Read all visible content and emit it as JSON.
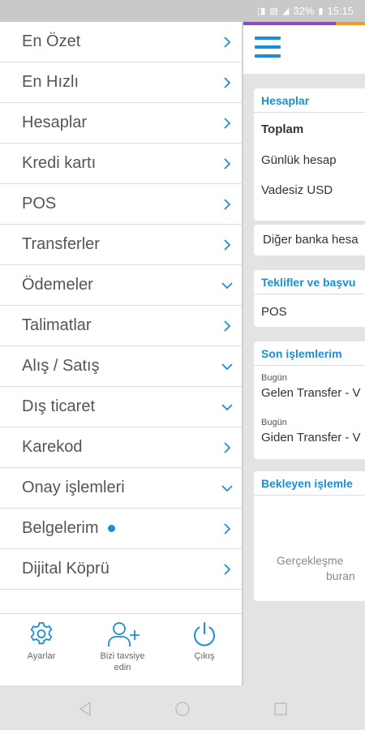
{
  "status_bar": {
    "battery": "32%",
    "time": "15:15"
  },
  "menu": {
    "items": [
      {
        "label": "En Özet",
        "chevron": "right"
      },
      {
        "label": "En Hızlı",
        "chevron": "right"
      },
      {
        "label": "Hesaplar",
        "chevron": "right"
      },
      {
        "label": "Kredi kartı",
        "chevron": "right"
      },
      {
        "label": "POS",
        "chevron": "right"
      },
      {
        "label": "Transferler",
        "chevron": "right"
      },
      {
        "label": "Ödemeler",
        "chevron": "down"
      },
      {
        "label": "Talimatlar",
        "chevron": "right"
      },
      {
        "label": "Alış / Satış",
        "chevron": "down"
      },
      {
        "label": "Dış ticaret",
        "chevron": "down"
      },
      {
        "label": "Karekod",
        "chevron": "right"
      },
      {
        "label": "Onay işlemleri",
        "chevron": "down"
      },
      {
        "label": "Belgelerim",
        "chevron": "right",
        "badge_dot": true
      },
      {
        "label": "Dijital Köprü",
        "chevron": "right"
      }
    ]
  },
  "footer": {
    "settings_label": "Ayarlar",
    "recommend_label_line1": "Bizi tavsiye",
    "recommend_label_line2": "edin",
    "logout_label": "Çıkış"
  },
  "main": {
    "accounts_card": {
      "title": "Hesaplar",
      "rows": [
        "Toplam",
        "Günlük hesap",
        "Vadesiz USD"
      ],
      "other_banks": "Diğer banka hesa"
    },
    "offers_card": {
      "title": "Teklifler ve başvu",
      "rows": [
        "POS"
      ]
    },
    "recent_card": {
      "title": "Son işlemlerim",
      "items": [
        {
          "date": "Bugün",
          "text": "Gelen Transfer - V"
        },
        {
          "date": "Bugün",
          "text": "Giden Transfer - V"
        }
      ]
    },
    "pending_card": {
      "title": "Bekleyen işlemle",
      "empty_line1": "Gerçekleşme",
      "empty_line2": "buran"
    }
  },
  "colors": {
    "accent_blue": "#1a8fd8",
    "stripe_purple": "#8a4bc8",
    "stripe_orange": "#f39a1e"
  },
  "icons": {
    "settings": "gear-icon",
    "recommend": "add-user-icon",
    "logout": "power-icon",
    "menu": "hamburger-icon"
  }
}
